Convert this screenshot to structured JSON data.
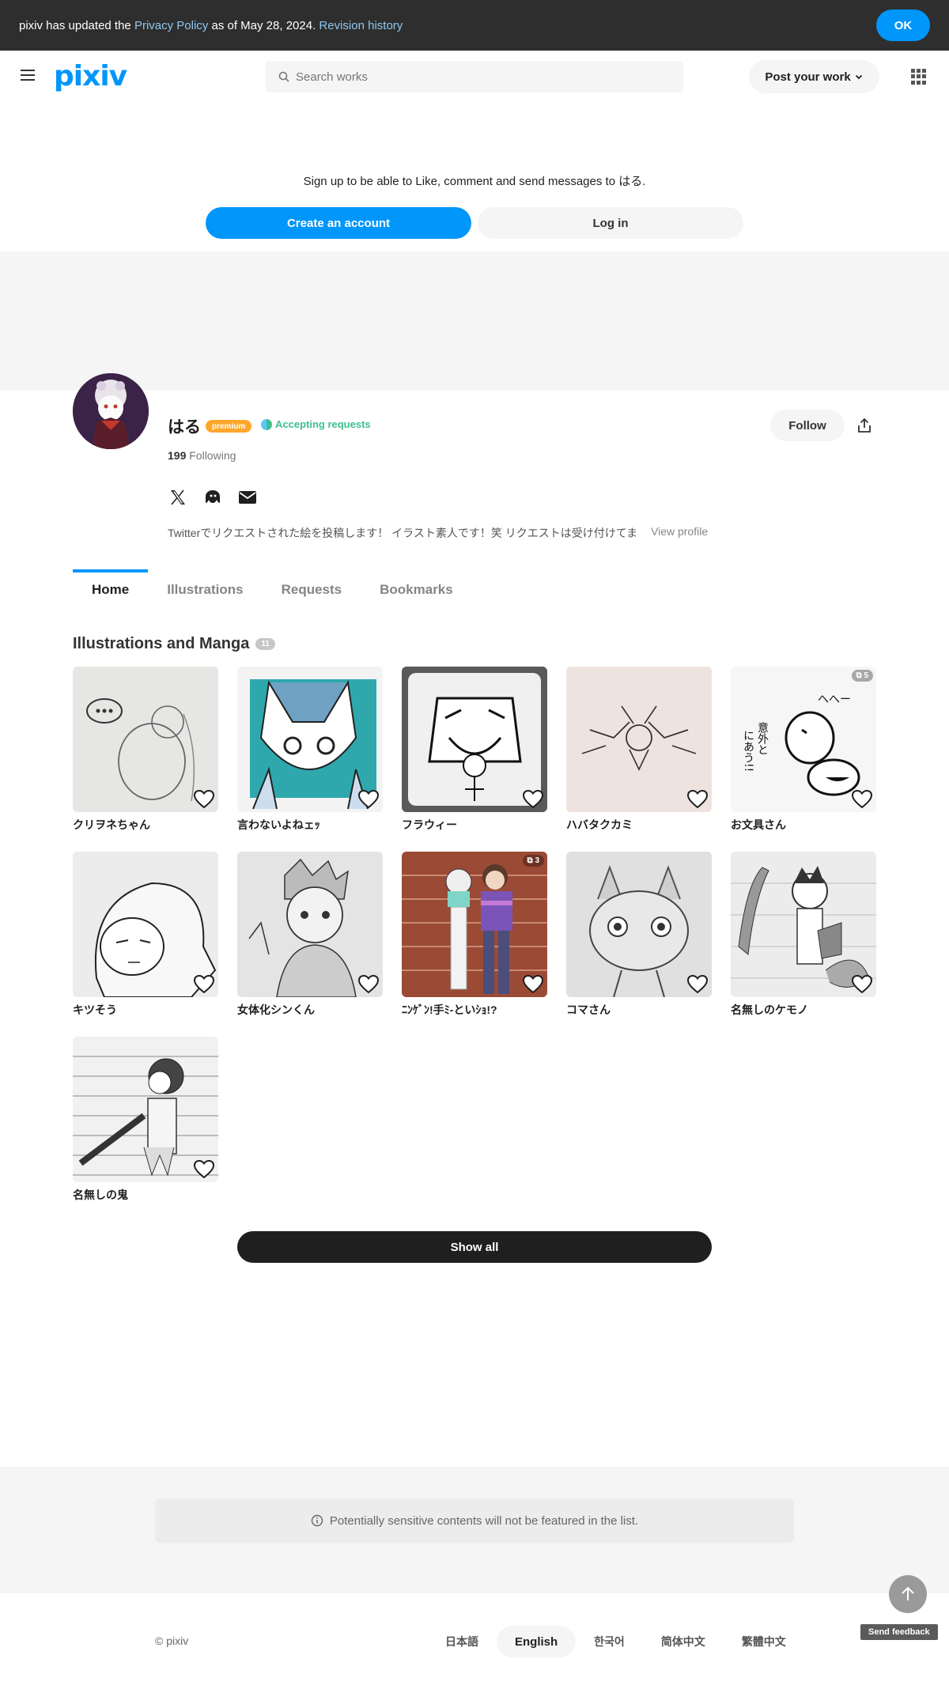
{
  "notice": {
    "prefix": "pixiv has updated the",
    "policy_link": "Privacy Policy",
    "middle": "as of May 28, 2024.",
    "revision_link": "Revision history",
    "ok_label": "OK"
  },
  "header": {
    "logo": "pixiv",
    "search_placeholder": "Search works",
    "post_label": "Post your work"
  },
  "signup": {
    "text": "Sign up to be able to Like, comment and send messages to はる.",
    "create_label": "Create an account",
    "login_label": "Log in"
  },
  "profile": {
    "name": "はる",
    "premium_badge": "premium",
    "accepting_label": "Accepting requests",
    "following_count": "199",
    "following_label": "Following",
    "follow_label": "Follow",
    "bio": "Twitterでリクエストされた絵を投稿します！ イラスト素人です！笑 リクエストは受け付けてま",
    "view_profile": "View profile",
    "social_icons": [
      "x-icon",
      "misskey-icon",
      "mail-icon"
    ]
  },
  "tabs": [
    "Home",
    "Illustrations",
    "Requests",
    "Bookmarks"
  ],
  "section": {
    "title": "Illustrations and Manga",
    "count": "11"
  },
  "works": [
    {
      "title": "クリヲネちゃん",
      "pages": ""
    },
    {
      "title": "言わないよねェｯ",
      "pages": ""
    },
    {
      "title": "フラウィー",
      "pages": ""
    },
    {
      "title": "ハバタクカミ",
      "pages": ""
    },
    {
      "title": "お文具さん",
      "pages": "5"
    },
    {
      "title": "キツそう",
      "pages": ""
    },
    {
      "title": "女体化シンくん",
      "pages": ""
    },
    {
      "title": "ﾆﾝｹﾞﾝ!手ﾐ-といｼｮ!?",
      "pages": "3"
    },
    {
      "title": "コマさん",
      "pages": ""
    },
    {
      "title": "名無しのケモノ",
      "pages": ""
    },
    {
      "title": "名無しの鬼",
      "pages": ""
    }
  ],
  "show_all_label": "Show all",
  "sensitive_notice": "Potentially sensitive contents will not be featured in the list.",
  "footer": {
    "copyright": "© pixiv",
    "languages": [
      "日本語",
      "English",
      "한국어",
      "简体中文",
      "繁體中文"
    ],
    "active_language": "English",
    "feedback_label": "Send feedback"
  },
  "colors": {
    "accent": "#0096fa",
    "premium": "#ffa72b",
    "accepting": "#3ec08d"
  }
}
